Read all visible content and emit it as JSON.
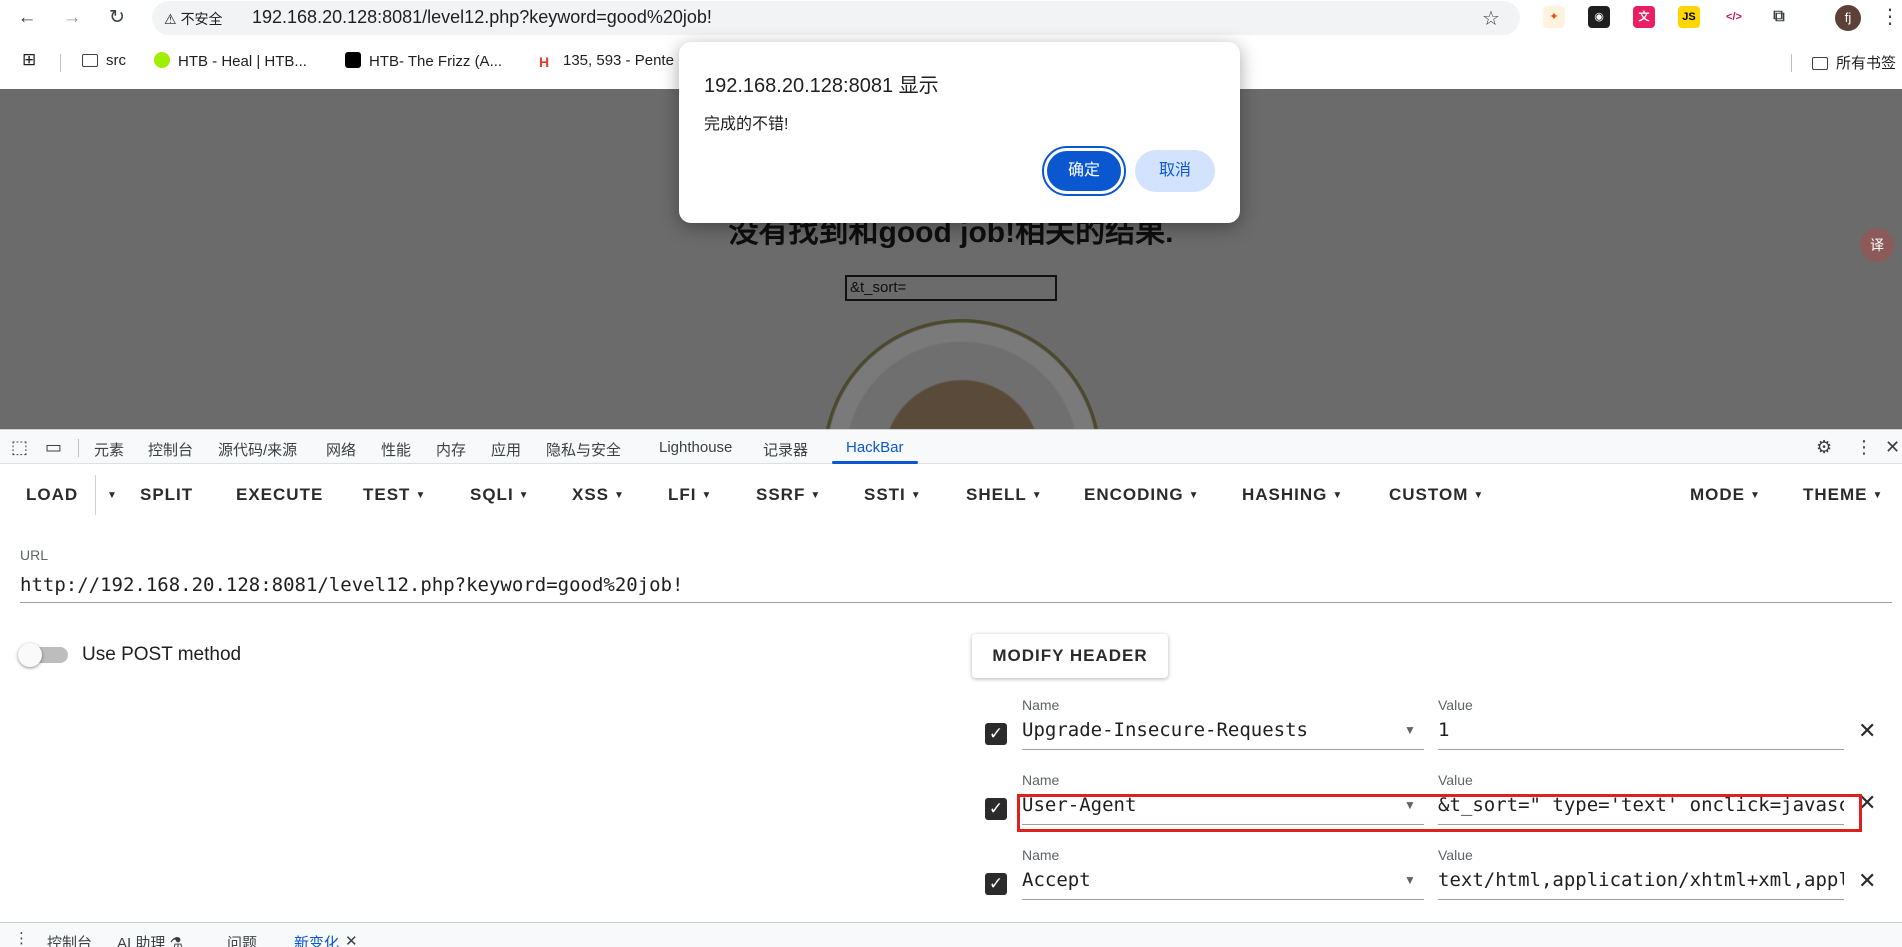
{
  "browser": {
    "nav": {
      "back": "←",
      "forward": "→",
      "reload": "↻"
    },
    "security_label": "不安全",
    "url": "192.168.20.128:8081/level12.php?keyword=good%20job!",
    "bookmarks": [
      "src",
      "HTB - Heal | HTB...",
      "HTB- The Frizz (A...",
      "135, 593 - Pente"
    ],
    "all_bookmarks": "所有书签",
    "profile_initial": "fj"
  },
  "page": {
    "heading": "没有找到和good job!相关的结果.",
    "input_value": "&t_sort="
  },
  "dialog": {
    "title": "192.168.20.128:8081 显示",
    "message": "完成的不错!",
    "ok": "确定",
    "cancel": "取消"
  },
  "devtools": {
    "tabs": [
      "元素",
      "控制台",
      "源代码/来源",
      "网络",
      "性能",
      "内存",
      "应用",
      "隐私与安全",
      "Lighthouse",
      "记录器",
      "HackBar"
    ],
    "active_tab": "HackBar",
    "drawer_tabs": [
      "控制台",
      "AI 助理 ⚗",
      "问题",
      "新变化"
    ],
    "drawer_active": "新变化"
  },
  "hackbar": {
    "toolbar_left": [
      "LOAD",
      "SPLIT",
      "EXECUTE",
      "TEST",
      "SQLI",
      "XSS",
      "LFI",
      "SSRF",
      "SSTI",
      "SHELL",
      "ENCODING",
      "HASHING",
      "CUSTOM"
    ],
    "toolbar_right": [
      "MODE",
      "THEME"
    ],
    "url_label": "URL",
    "url_value": "http://192.168.20.128:8081/level12.php?keyword=good%20job!",
    "post_label": "Use POST method",
    "post_enabled": false,
    "modify_header_label": "MODIFY HEADER",
    "name_label": "Name",
    "value_label": "Value",
    "headers": [
      {
        "name": "Upgrade-Insecure-Requests",
        "value": "1",
        "checked": true
      },
      {
        "name": "User-Agent",
        "value": "&t_sort=\" type='text' onclick=javascript:alert()",
        "checked": true
      },
      {
        "name": "Accept",
        "value": "text/html,application/xhtml+xml,application/xml",
        "checked": true
      }
    ]
  },
  "colors": {
    "accent": "#0b57d0",
    "highlight": "#e0201c",
    "dim_overlay": "#6b6b6b"
  }
}
